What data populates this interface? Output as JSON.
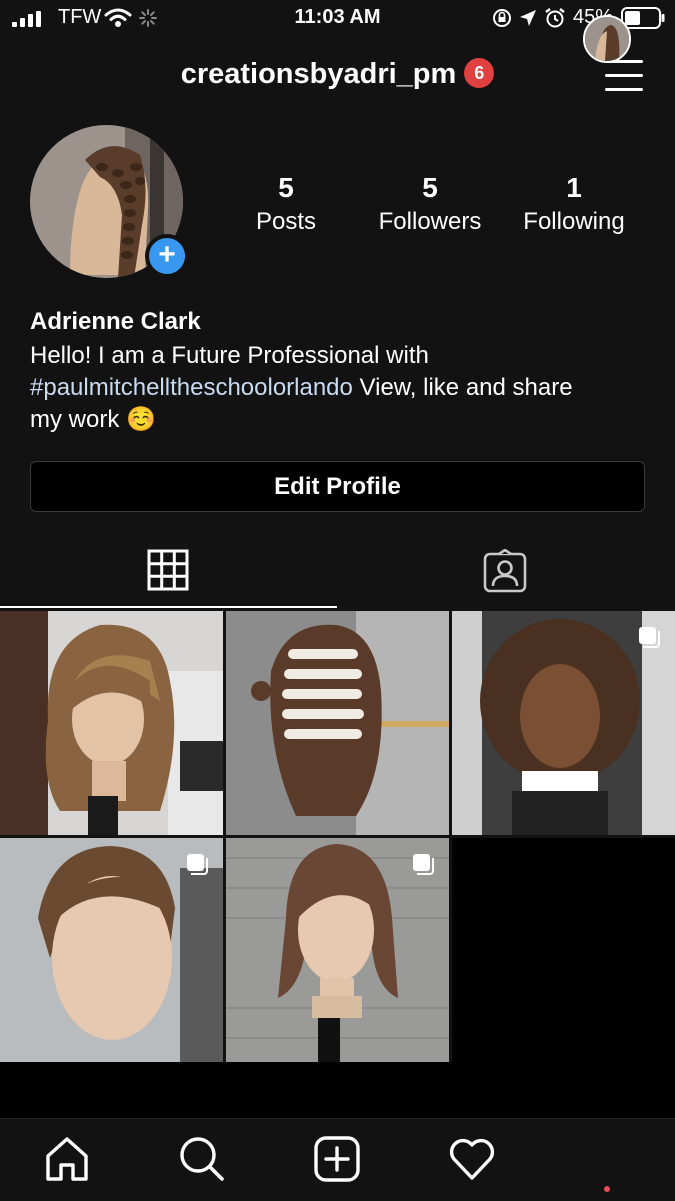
{
  "status_bar": {
    "carrier": "TFW",
    "time": "11:03 AM",
    "battery_percent": "45%"
  },
  "header": {
    "username": "creationsbyadri_pm",
    "notification_count": "6"
  },
  "profile": {
    "stats": [
      {
        "value": "5",
        "label": "Posts"
      },
      {
        "value": "5",
        "label": "Followers"
      },
      {
        "value": "1",
        "label": "Following"
      }
    ],
    "full_name": "Adrienne Clark",
    "bio_line1": "Hello! I am a Future Professional  with",
    "bio_hashtag": "#paulmitchelltheschoolorlando",
    "bio_line2_rest": "  View, like and share",
    "bio_line3": "my work ☺️",
    "edit_button_label": "Edit Profile"
  },
  "tabs": [
    {
      "icon": "grid-icon",
      "active": true
    },
    {
      "icon": "tagged-icon",
      "active": false
    }
  ],
  "posts": [
    {
      "icon": "mannequin-bangs-photo",
      "multiple": false
    },
    {
      "icon": "perm-rods-photo",
      "multiple": false
    },
    {
      "icon": "curly-mannequin-photo",
      "multiple": true
    },
    {
      "icon": "updo-mannequin-photo",
      "multiple": true
    },
    {
      "icon": "bob-mannequin-photo",
      "multiple": true
    }
  ],
  "bottom_nav": [
    "home-icon",
    "search-icon",
    "new-post-icon",
    "activity-heart-icon",
    "profile-avatar"
  ],
  "colors": {
    "background": "#121212",
    "badge": "#e0403f",
    "add_button": "#3897f0",
    "hashtag": "#c9dbf2"
  }
}
